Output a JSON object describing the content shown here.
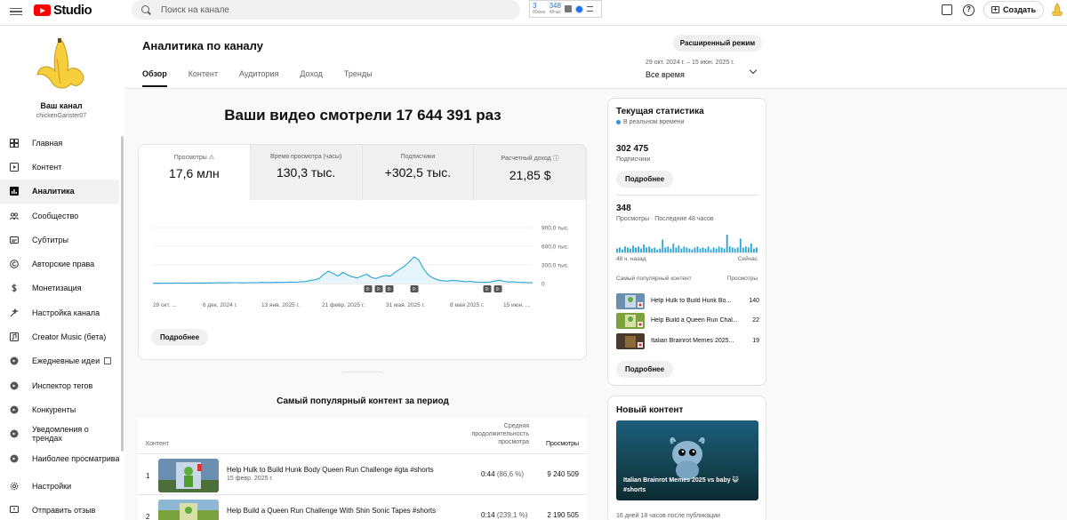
{
  "app": {
    "logo_text": "Studio"
  },
  "search": {
    "placeholder": "Поиск на канале"
  },
  "extension": {
    "a_num": "3",
    "a_lbl": "80мин",
    "b_num": "348",
    "b_lbl": "48час"
  },
  "topbar": {
    "create_label": "Создать"
  },
  "channel": {
    "name": "Ваш канал",
    "handle": "chickenGanster07"
  },
  "nav": {
    "items": [
      {
        "label": "Главная",
        "icon": "dashboard-icon"
      },
      {
        "label": "Контент",
        "icon": "content-icon"
      },
      {
        "label": "Аналитика",
        "icon": "analytics-icon"
      },
      {
        "label": "Сообщество",
        "icon": "community-icon"
      },
      {
        "label": "Субтитры",
        "icon": "subtitles-icon"
      },
      {
        "label": "Авторские права",
        "icon": "copyright-icon"
      },
      {
        "label": "Монетизация",
        "icon": "dollar-icon"
      },
      {
        "label": "Настройка канала",
        "icon": "customize-icon"
      },
      {
        "label": "Creator Music (бета)",
        "icon": "music-icon"
      },
      {
        "label": "Ежедневные идеи",
        "icon": "ideas-icon"
      },
      {
        "label": "Инспектор тегов",
        "icon": "tags-icon"
      },
      {
        "label": "Конкуренты",
        "icon": "competitors-icon"
      },
      {
        "label": "Уведомления о трендах",
        "icon": "trends-icon"
      },
      {
        "label": "Наиболее просматриваемые",
        "icon": "most-viewed-icon"
      }
    ],
    "settings": "Настройки",
    "feedback": "Отправить отзыв"
  },
  "page": {
    "title": "Аналитика по каналу",
    "tabs": [
      "Обзор",
      "Контент",
      "Аудитория",
      "Доход",
      "Тренды"
    ],
    "advanced_button": "Расширенный режим",
    "date_range": "29 окт. 2024 г. – 15 июн. 2025 г.",
    "date_value": "Все время"
  },
  "overview": {
    "headline": "Ваши видео смотрели 17 644 391 раз",
    "metrics": [
      {
        "label": "Просмотры",
        "value": "17,6 млн"
      },
      {
        "label": "Время просмотра (часы)",
        "value": "130,3 тыс."
      },
      {
        "label": "Подписчики",
        "value": "+302,5 тыс."
      },
      {
        "label": "Расчетный доход",
        "value": "21,85 $"
      }
    ],
    "more_button": "Подробнее"
  },
  "chart_data": {
    "type": "line",
    "title": "",
    "x_ticks": [
      "29 окт. ...",
      "6 дек. 2024 г.",
      "13 янв. 2025 г.",
      "21 февр. 2025 г.",
      "31 мая. 2025 г.",
      "8 мая 2025 г.",
      "15 июн. ..."
    ],
    "y_ticks": [
      "900,0 тыс.",
      "600,0 тыс.",
      "300,0 тыс.",
      "0"
    ],
    "ylim": [
      0,
      900000
    ],
    "markers": [
      "9:",
      "9:",
      "9:",
      "9:",
      "9:",
      "9:"
    ],
    "series": [
      {
        "values": [
          5000,
          6000,
          5000,
          7000,
          6000,
          8000,
          7000,
          6000,
          9000,
          8000,
          10000,
          9000,
          12000,
          10000,
          14000,
          12000,
          13000,
          15000,
          14000,
          12000,
          15000,
          16000,
          14000,
          18000,
          16000,
          17000,
          20000,
          18000,
          22000,
          25000,
          22000,
          28000,
          32000,
          45000,
          60000,
          80000,
          150000,
          200000,
          160000,
          120000,
          180000,
          140000,
          110000,
          90000,
          120000,
          150000,
          100000,
          80000,
          110000,
          130000,
          120000,
          180000,
          230000,
          280000,
          350000,
          430000,
          380000,
          240000,
          140000,
          90000,
          60000,
          45000,
          40000,
          50000,
          45000,
          38000,
          30000,
          35000,
          25000,
          22000,
          20000,
          25000,
          40000,
          55000,
          35000,
          25000,
          28000,
          22000,
          18000,
          15000,
          16000
        ]
      }
    ]
  },
  "top_content": {
    "title": "Самый популярный контент за период",
    "col_content": "Контент",
    "col_duration": "Средняя продолжительность просмотра",
    "col_views": "Просмотры",
    "rows": [
      {
        "num": "1",
        "title": "Help Hulk to Build Hunk Body Queen Run Challenge #gta #shorts",
        "date": "15 февр. 2025 г.",
        "duration": "0:44",
        "pct": "(86,6 %)",
        "views": "9 240 509"
      },
      {
        "num": "2",
        "title": "Help Build a Queen Run Challenge With Shin Sonic Tapes #shorts",
        "date": "",
        "duration": "0:14",
        "pct": "(239,1 %)",
        "views": "2 190 505"
      }
    ]
  },
  "realtime": {
    "title": "Текущая статистика",
    "live": "В реальном времени",
    "subs": "302 475",
    "subs_label": "Подписчики",
    "more": "Подробнее",
    "views": "348",
    "views_label": "Просмотры · Последние 48 часов",
    "ax_left": "48 ч. назад",
    "ax_right": "Сейчас",
    "popular_label": "Самый популярный контент",
    "popular_views_label": "Просмотры",
    "spark": [
      4,
      5,
      3,
      6,
      5,
      4,
      7,
      5,
      6,
      4,
      8,
      5,
      6,
      4,
      5,
      3,
      4,
      13,
      5,
      6,
      4,
      9,
      5,
      7,
      4,
      6,
      5,
      4,
      3,
      5,
      6,
      4,
      5,
      4,
      6,
      3,
      5,
      4,
      6,
      5,
      4,
      18,
      6,
      5,
      4,
      5,
      14,
      5,
      6,
      5,
      9,
      4,
      5
    ],
    "popular": [
      {
        "title": "Help Hulk to Build Hunk Bo...",
        "views": "140"
      },
      {
        "title": "Help Build a Queen Run Chal...",
        "views": "22"
      },
      {
        "title": "Italian Brainrot Memes 2025...",
        "views": "19"
      }
    ],
    "more2": "Подробнее"
  },
  "new_content": {
    "title": "Новый контент",
    "thumb_text": "Italian Brainrot Memes 2025 vs baby 😺 #shorts",
    "meta": "16 дней 18 часов после публикации"
  }
}
